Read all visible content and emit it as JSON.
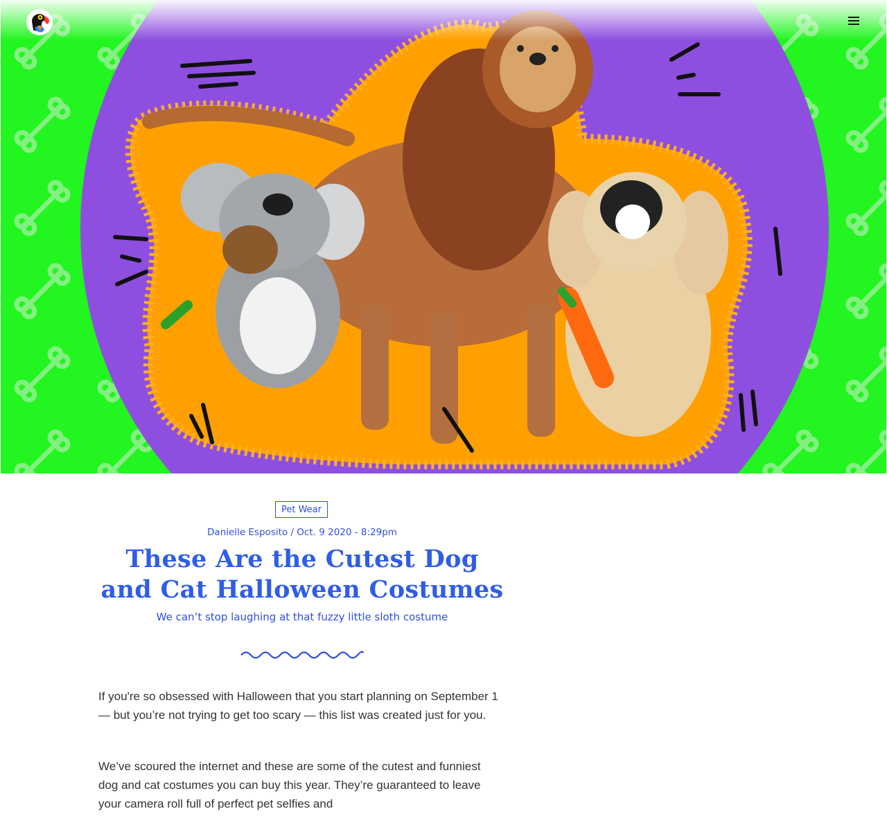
{
  "header": {
    "logo_icon": "parrot-logo-icon",
    "menu_icon": "hamburger-menu-icon"
  },
  "hero": {
    "background_color": "#22f520",
    "circle_color": "#8e4fe0",
    "glow_color": "#ff9f00"
  },
  "article": {
    "category": "Pet Wear",
    "author": "Danielle Esposito",
    "separator": "/",
    "date": "Oct. 9 2020 - 8:29pm",
    "title": "These Are the Cutest Dog and Cat Halloween Costumes",
    "subtitle": "We can’t stop laughing at that fuzzy little sloth costume",
    "paragraphs": [
      "If you're so obsessed with Halloween that you start planning on September 1 — but you’re not trying to get too scary — this list was created just for you.",
      "We’ve scoured the internet and these are some of the cutest and funniest dog and cat costumes you can buy this year. They’re guaranteed to leave your camera roll full of perfect pet selfies and"
    ]
  },
  "colors": {
    "accent": "#2f4fe0",
    "title": "#2f5de6"
  }
}
